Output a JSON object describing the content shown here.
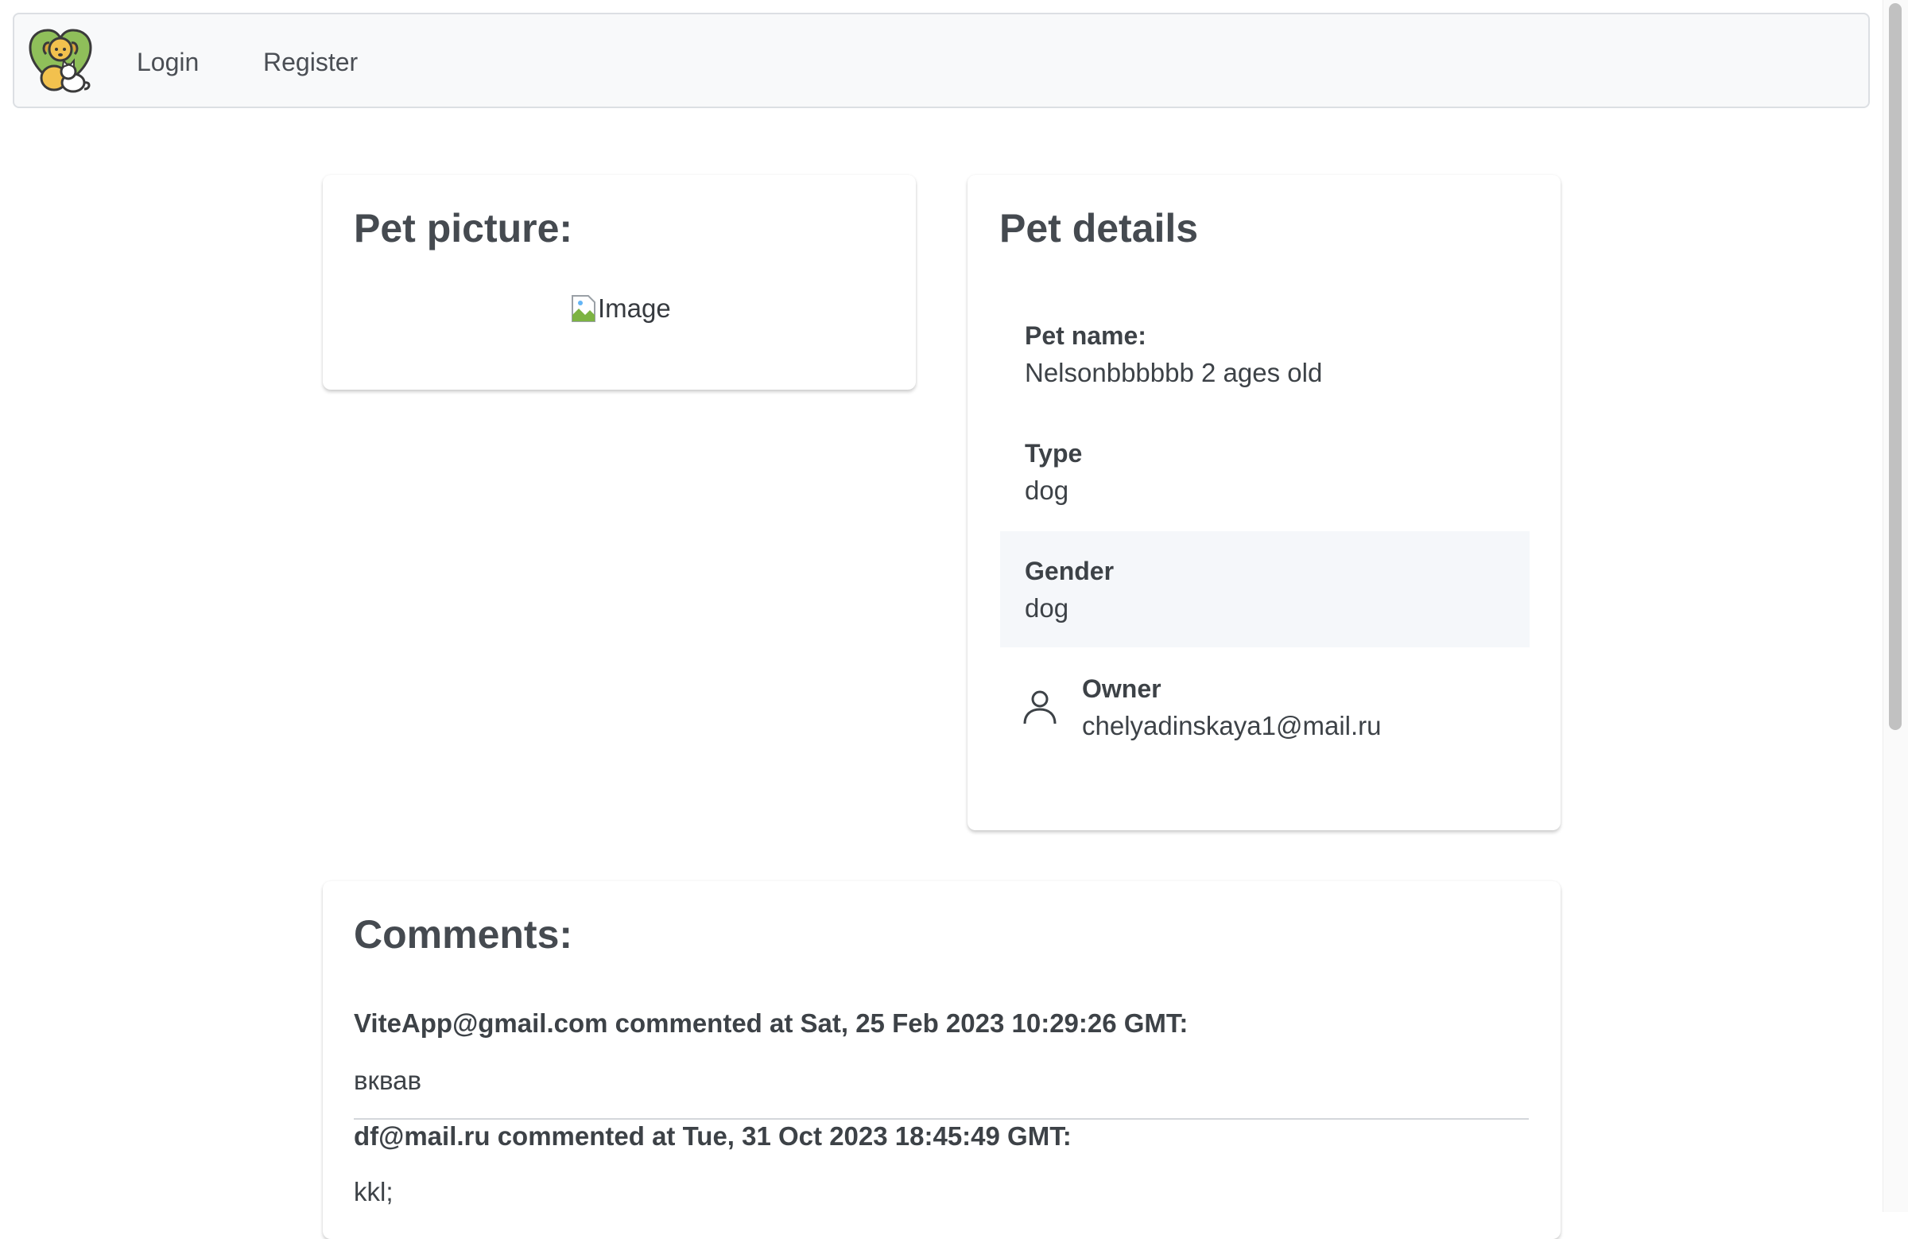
{
  "nav": {
    "logo_icon": "dog-and-cat-heart-logo",
    "login_label": "Login",
    "register_label": "Register"
  },
  "pet_picture": {
    "title": "Pet picture:",
    "image_alt": "Image"
  },
  "pet_details": {
    "title": "Pet details",
    "name_label": "Pet name:",
    "name_value": "Nelsonbbbbbb 2 ages old",
    "type_label": "Type",
    "type_value": "dog",
    "gender_label": "Gender",
    "gender_value": "dog",
    "owner_icon": "person-icon",
    "owner_label": "Owner",
    "owner_value": "chelyadinskaya1@mail.ru"
  },
  "comments": {
    "title": "Comments:",
    "items": [
      {
        "header": "ViteApp@gmail.com commented at Sat, 25 Feb 2023 10:29:26 GMT:",
        "text": "вквав"
      },
      {
        "header": "df@mail.ru commented at Tue, 31 Oct 2023 18:45:49 GMT:",
        "text": "kkl;"
      }
    ]
  },
  "colors": {
    "navbar_bg": "#f8f9fa",
    "text": "#3d4247",
    "highlight_row": "#f5f7fa"
  }
}
